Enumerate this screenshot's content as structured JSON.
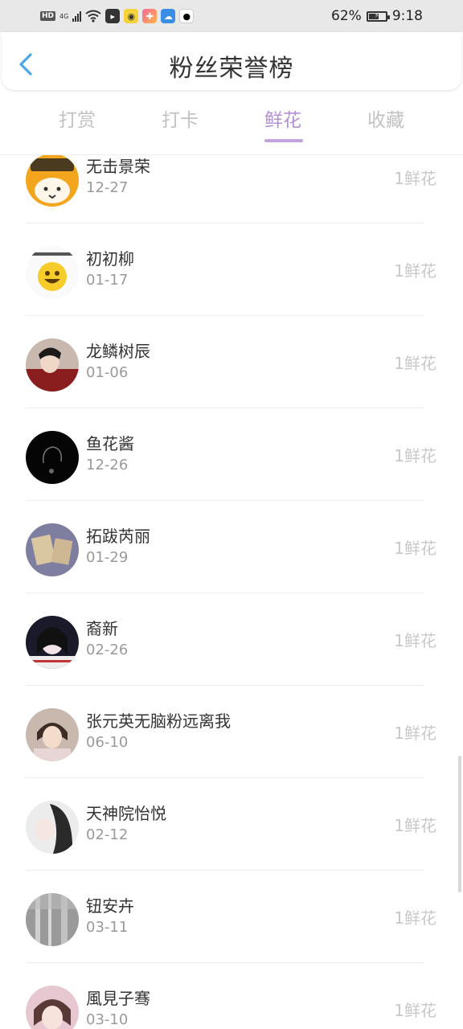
{
  "status_bar": {
    "hd": "HD",
    "network": "4G",
    "battery_percent": "62%",
    "battery_level": 0.62,
    "time": "9:18"
  },
  "header": {
    "title": "粉丝荣誉榜",
    "back_icon": "chevron-left-icon",
    "accent_color": "#4aa8e6"
  },
  "tabs": [
    {
      "label": "打赏",
      "active": false
    },
    {
      "label": "打卡",
      "active": false
    },
    {
      "label": "鲜花",
      "active": true
    },
    {
      "label": "收藏",
      "active": false
    }
  ],
  "tab_active_color": "#b58fd6",
  "fans": [
    {
      "name": "无击景荣",
      "date": "12-27",
      "value": "1鲜花"
    },
    {
      "name": "初初柳",
      "date": "01-17",
      "value": "1鲜花"
    },
    {
      "name": "龙鳞树辰",
      "date": "01-06",
      "value": "1鲜花"
    },
    {
      "name": "鱼花酱",
      "date": "12-26",
      "value": "1鲜花"
    },
    {
      "name": "拓跋芮丽",
      "date": "01-29",
      "value": "1鲜花"
    },
    {
      "name": "裔新",
      "date": "02-26",
      "value": "1鲜花"
    },
    {
      "name": "张元英无脑粉远离我",
      "date": "06-10",
      "value": "1鲜花"
    },
    {
      "name": "天神院怡悦",
      "date": "02-12",
      "value": "1鲜花"
    },
    {
      "name": "钮安卉",
      "date": "03-11",
      "value": "1鲜花"
    },
    {
      "name": "風見子骞",
      "date": "03-10",
      "value": "1鲜花"
    }
  ]
}
